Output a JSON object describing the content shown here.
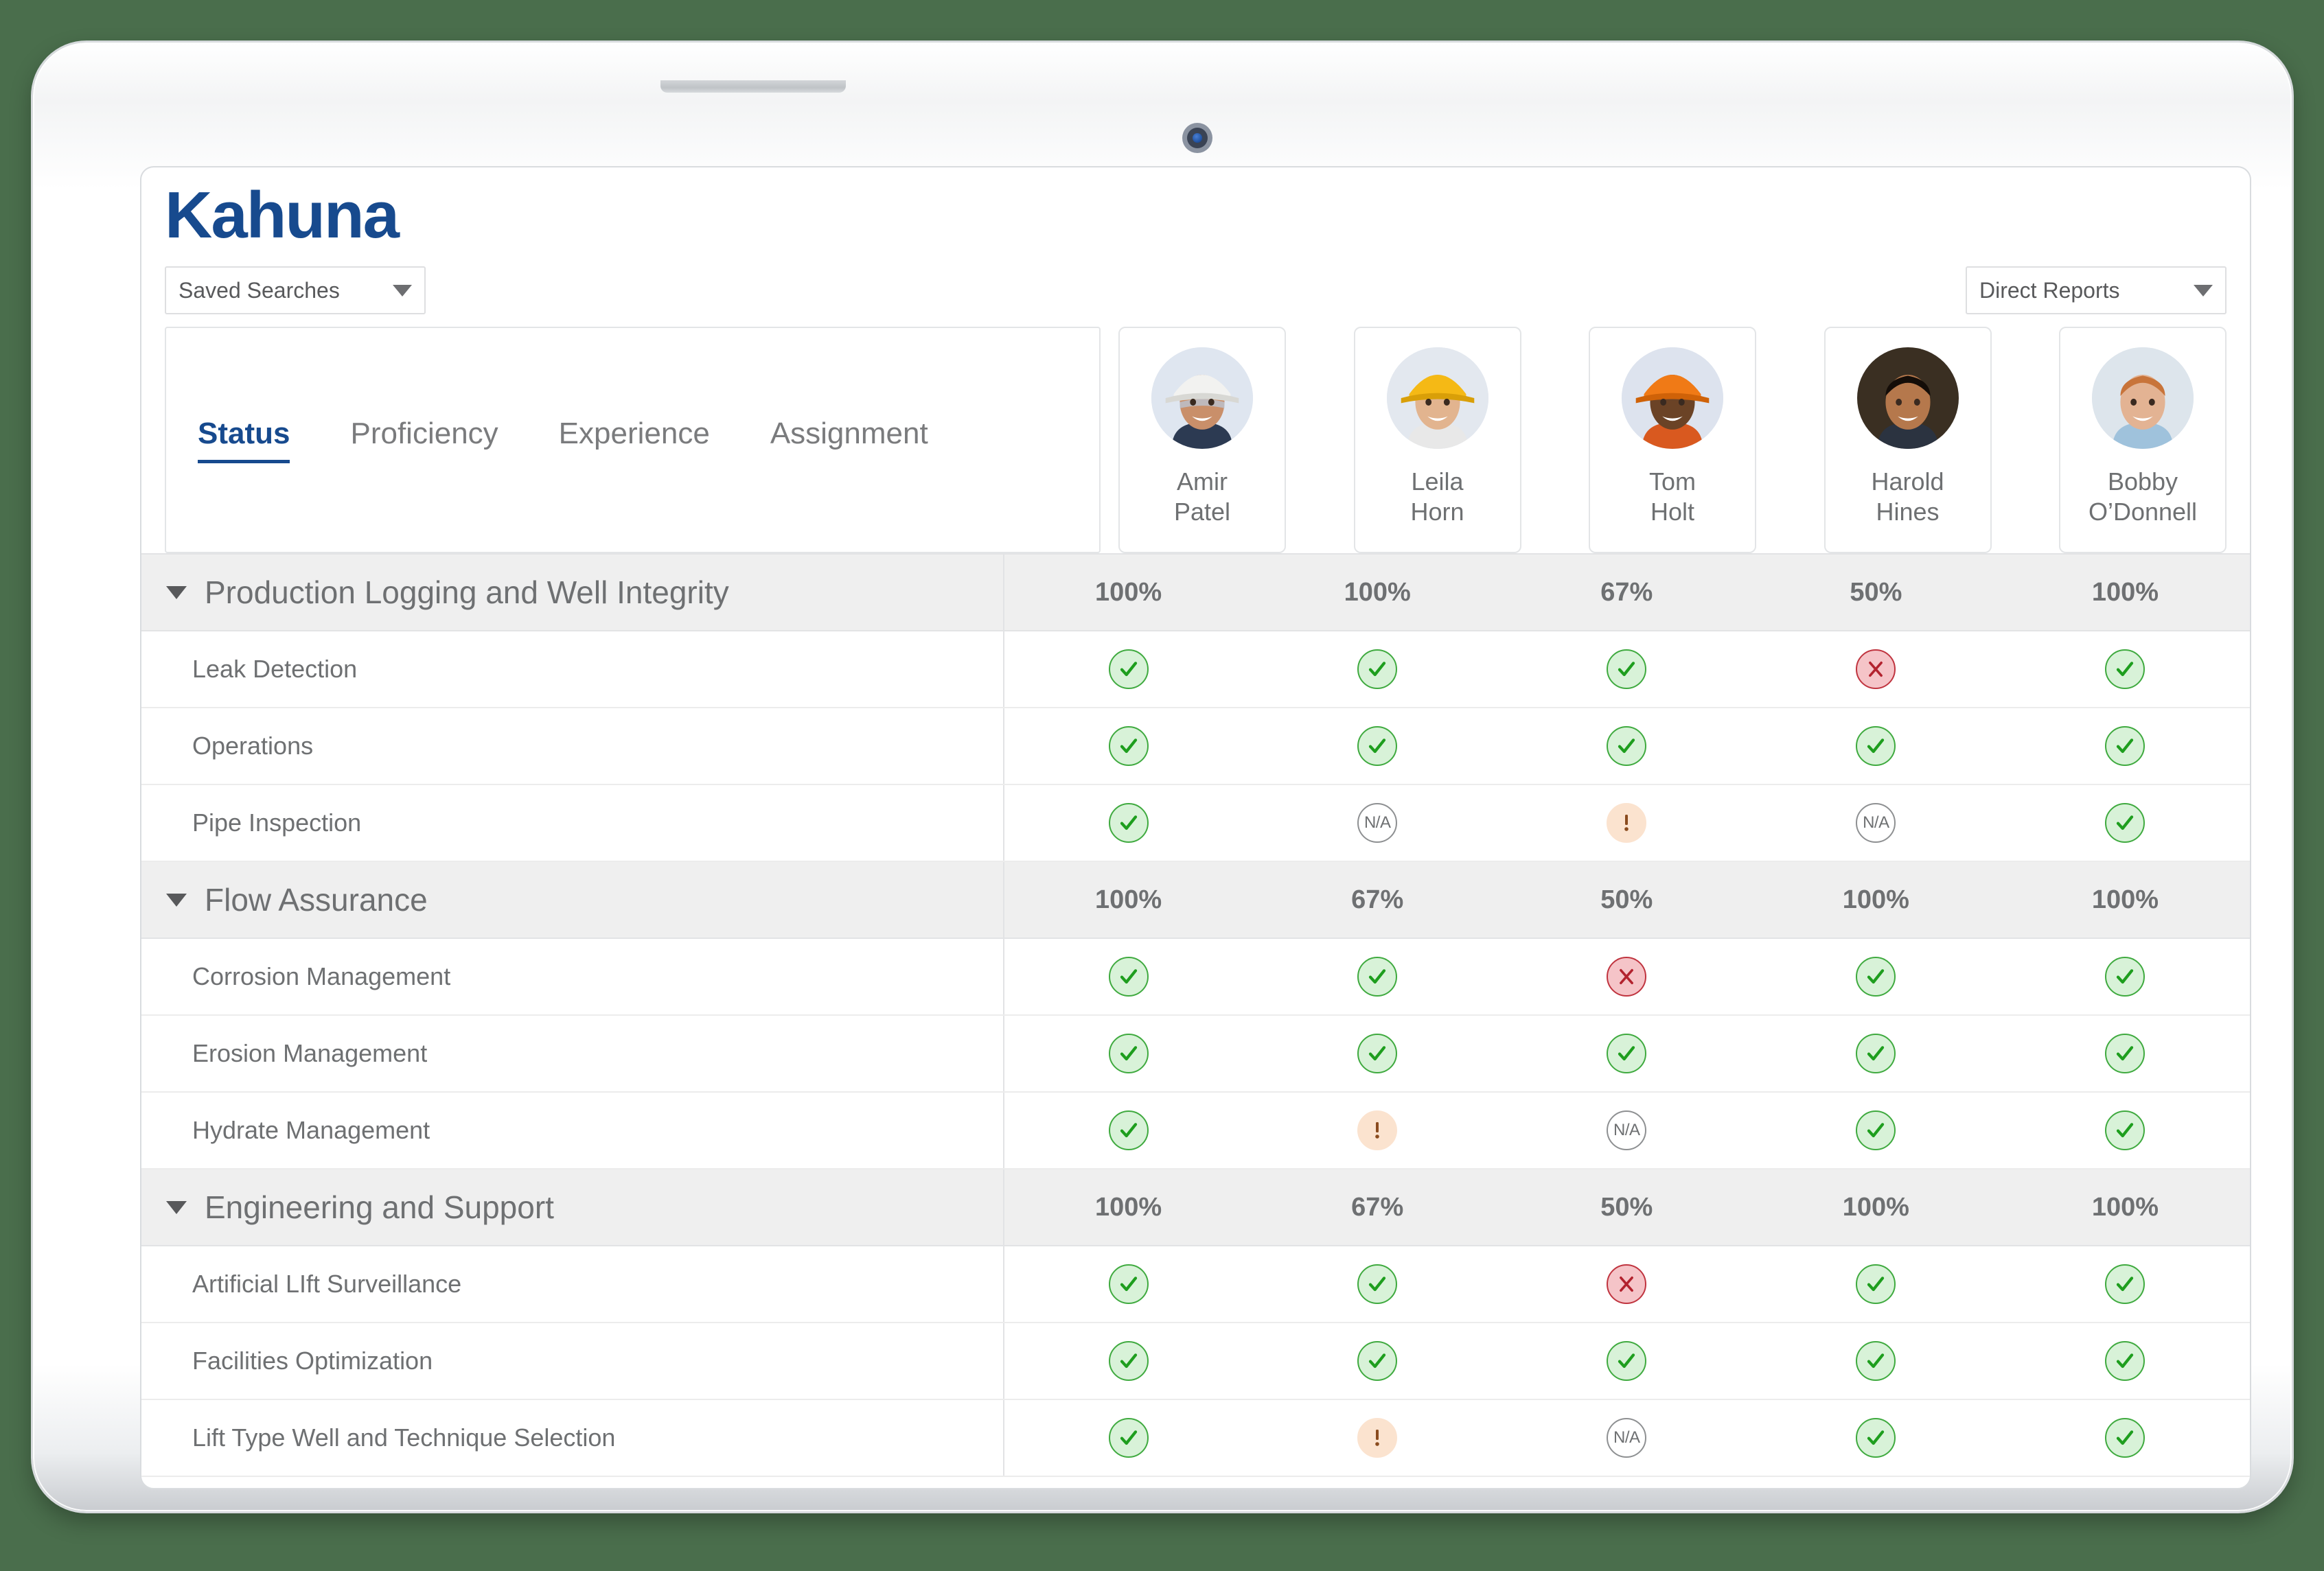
{
  "brand": {
    "name": "Kahuna"
  },
  "header": {
    "saved_searches": {
      "label": "Saved Searches",
      "caret_icon": "chevron-down-icon"
    },
    "direct_reports": {
      "label": "Direct Reports",
      "caret_icon": "chevron-down-icon"
    }
  },
  "tabs": [
    {
      "label": "Status",
      "active": true
    },
    {
      "label": "Proficiency",
      "active": false
    },
    {
      "label": "Experience",
      "active": false
    },
    {
      "label": "Assignment",
      "active": false
    }
  ],
  "persons": [
    {
      "first": "Amir",
      "last": "Patel",
      "display": "Amir\nPatel",
      "avatar": "worker-white-hardhat"
    },
    {
      "first": "Leila",
      "last": "Horn",
      "display": "Leila\nHorn",
      "avatar": "worker-yellow-hardhat"
    },
    {
      "first": "Tom",
      "last": "Holt",
      "display": "Tom\nHolt",
      "avatar": "worker-orange-hardhat"
    },
    {
      "first": "Harold",
      "last": "Hines",
      "display": "Harold\nHines",
      "avatar": "man-dark-background"
    },
    {
      "first": "Bobby",
      "last": "O’Donnell",
      "display": "Bobby\nO’Donnell",
      "avatar": "man-light-background"
    }
  ],
  "legend": {
    "ok": "check-circle-icon",
    "fail": "x-circle-icon",
    "warn": "exclamation-circle-icon",
    "na": "N/A"
  },
  "colors": {
    "brand_blue": "#174a8e",
    "ok_fill": "#d8f2d8",
    "ok_stroke": "#3faa3f",
    "fail_fill": "#f5c4c8",
    "fail_stroke": "#c0343f",
    "warn_fill": "#fbe3cf",
    "warn_stroke": "#8a4b1e",
    "na_stroke": "#8e9092",
    "group_row_bg": "#efefef",
    "text_gray": "#6e7072",
    "page_bg": "#4a6e4c"
  },
  "chart_data": {
    "type": "table",
    "title": "Status",
    "columns": [
      "Amir Patel",
      "Leila Horn",
      "Tom Holt",
      "Harold Hines",
      "Bobby O’Donnell"
    ],
    "groups": [
      {
        "name": "Production Logging and Well Integrity",
        "expanded": true,
        "percentages": [
          "100%",
          "100%",
          "67%",
          "50%",
          "100%"
        ],
        "skills": [
          {
            "name": "Leak Detection",
            "statuses": [
              "ok",
              "ok",
              "ok",
              "fail",
              "ok"
            ]
          },
          {
            "name": "Operations",
            "statuses": [
              "ok",
              "ok",
              "ok",
              "ok",
              "ok"
            ]
          },
          {
            "name": "Pipe Inspection",
            "statuses": [
              "ok",
              "na",
              "warn",
              "na",
              "ok"
            ]
          }
        ]
      },
      {
        "name": "Flow Assurance",
        "expanded": true,
        "percentages": [
          "100%",
          "67%",
          "50%",
          "100%",
          "100%"
        ],
        "skills": [
          {
            "name": "Corrosion Management",
            "statuses": [
              "ok",
              "ok",
              "fail",
              "ok",
              "ok"
            ]
          },
          {
            "name": "Erosion Management",
            "statuses": [
              "ok",
              "ok",
              "ok",
              "ok",
              "ok"
            ]
          },
          {
            "name": "Hydrate Management",
            "statuses": [
              "ok",
              "warn",
              "na",
              "ok",
              "ok"
            ]
          }
        ]
      },
      {
        "name": "Engineering and Support",
        "expanded": true,
        "percentages": [
          "100%",
          "67%",
          "50%",
          "100%",
          "100%"
        ],
        "skills": [
          {
            "name": "Artificial LIft Surveillance",
            "statuses": [
              "ok",
              "ok",
              "fail",
              "ok",
              "ok"
            ]
          },
          {
            "name": "Facilities Optimization",
            "statuses": [
              "ok",
              "ok",
              "ok",
              "ok",
              "ok"
            ]
          },
          {
            "name": "Lift Type Well and Technique Selection",
            "statuses": [
              "ok",
              "warn",
              "na",
              "ok",
              "ok"
            ]
          }
        ]
      }
    ]
  }
}
